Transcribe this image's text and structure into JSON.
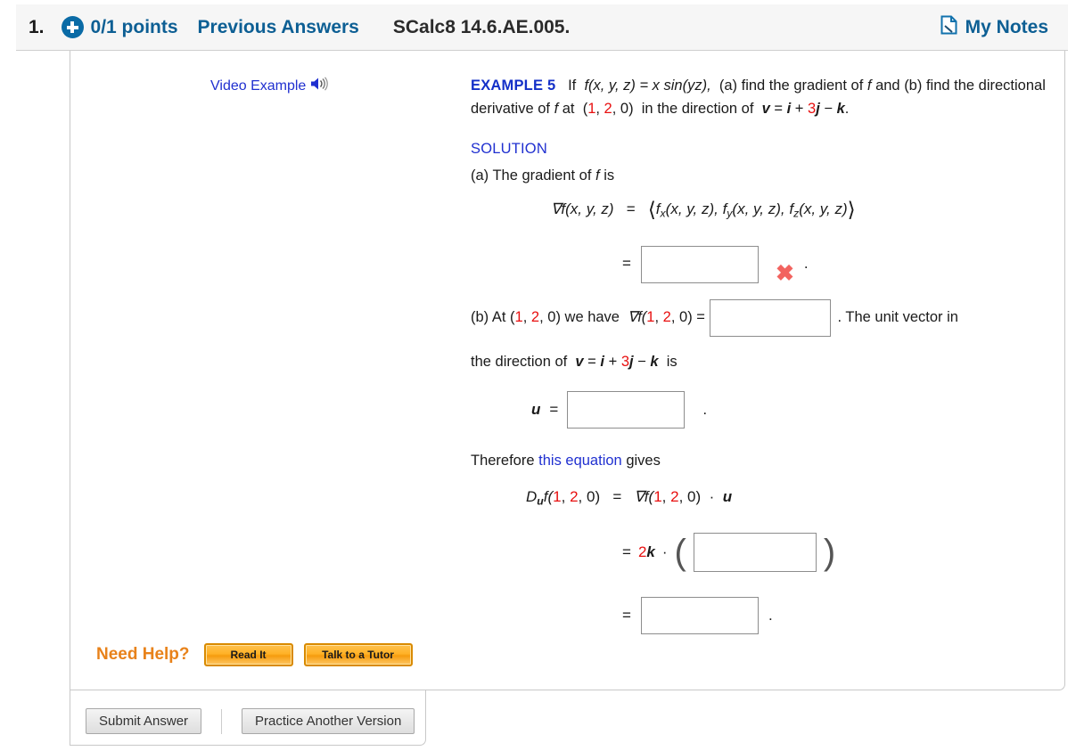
{
  "header": {
    "question_number": "1.",
    "plus_icon": "plus-circle-icon",
    "points": "0/1 points",
    "previous_answers": "Previous Answers",
    "exercise_id": "SCalc8 14.6.AE.005.",
    "notes_icon": "note-page-icon",
    "notes_label": "My Notes"
  },
  "left_panel": {
    "video_example_label": "Video Example",
    "speaker_icon": "speaker-sound-icon",
    "need_help_label": "Need Help?",
    "read_it_label": "Read It",
    "tutor_label": "Talk to a Tutor"
  },
  "footer": {
    "submit_label": "Submit Answer",
    "practice_label": "Practice Another Version"
  },
  "problem": {
    "example_head": "EXAMPLE 5",
    "statement_1": "If",
    "statement_fn": "f(x, y, z) = x sin(yz),",
    "statement_2": "(a) find the gradient of",
    "statement_f": "f",
    "statement_3": "and (b) find",
    "statement_4": "the directional derivative of",
    "statement_5": "at",
    "point_open": "(",
    "point_1": "1",
    "point_c1": ", ",
    "point_2": "2",
    "point_c2": ", ",
    "point_0": "0",
    "point_close": ")",
    "statement_6": "in the direction of",
    "v_label": "v",
    "v_eq": " = ",
    "v_i": "i",
    "v_plus": " + ",
    "v_3": "3",
    "v_j": "j",
    "v_minus": " − ",
    "v_k": "k",
    "v_period": ".",
    "solution_head": "SOLUTION",
    "part_a_line": "(a) The gradient of",
    "part_a_is": "is",
    "grad_lhs": "∇f(x, y, z)",
    "grad_eq": "=",
    "grad_open": "⟨",
    "grad_fx": "f",
    "grad_fx_sub": "x",
    "grad_fx_args": "(x, y, z), ",
    "grad_fy": "f",
    "grad_fy_sub": "y",
    "grad_fy_args": "(x, y, z), ",
    "grad_fz": "f",
    "grad_fz_sub": "z",
    "grad_fz_args": "(x, y, z)",
    "grad_close": "⟩",
    "eq_symbol": "=",
    "period": ".",
    "x_mark": "✖",
    "part_b_prefix": "(b) At",
    "part_b_mid": "we have",
    "grad_at_point": "∇f(",
    "part_b_eq": "=",
    "part_b_suffix": ".  The unit vector in",
    "part_b_line2_pre": "the direction of",
    "part_b_line2_is": "is",
    "u_label": "u",
    "u_eq": "=",
    "therefore_pre": "Therefore",
    "therefore_link": "this equation",
    "therefore_post": "gives",
    "duf_D": "D",
    "duf_u": "u",
    "duf_f": "f(",
    "duf_eq": "=",
    "duf_dot": "·",
    "two_k_2": "2",
    "two_k_k": "k",
    "two_k_dot": "·",
    "paren_open": "(",
    "paren_close": ")",
    "answers": {
      "gradient_value": "",
      "gradient_at_point_value": "",
      "unit_vector_value": "",
      "dot_product_value": "",
      "final_value": ""
    },
    "placeholders": {
      "gradient_value": "",
      "gradient_at_point_value": "",
      "unit_vector_value": "",
      "dot_product_value": "",
      "final_value": ""
    }
  },
  "colors": {
    "link_blue": "#2030d0",
    "header_blue": "#0d5f94",
    "red": "#e81010",
    "orange": "#e8821a",
    "x_red": "#f2635f"
  }
}
